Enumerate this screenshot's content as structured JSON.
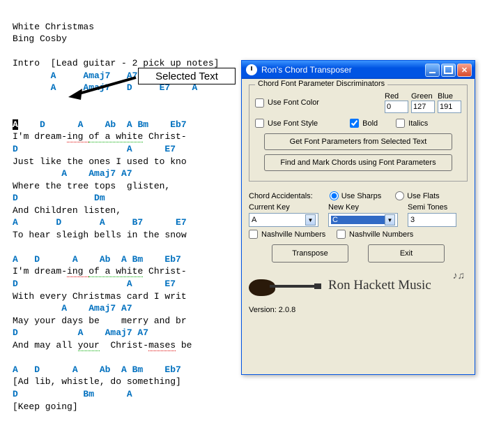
{
  "doc": {
    "title": "White Christmas",
    "artist": "Bing Cosby",
    "intro_label": "Intro",
    "intro_note": "[Lead guitar - 2 pick up notes]",
    "chord_rows": {
      "r1": "A     Amaj7   A7     D     Dm",
      "r2": "A     Amaj7   D     E7    A",
      "r3a": "    D      A    Ab  A Bm    Eb7",
      "r4a": "D                    A      E7",
      "r5a": "         A    Amaj7 A7",
      "r6a": "D              Dm",
      "r7a": "A       D       A     B7      E7",
      "r3b": "A   D      A    Ab  A Bm    Eb7",
      "r4b": "D                    A      E7",
      "r5b": "         A    Amaj7 A7",
      "r6b": "D           A    Amaj7 A7",
      "r8": "A   D      A    Ab  A Bm    Eb7",
      "r9": "D            Bm      A"
    },
    "lyrics": {
      "l1a": "I'm dream-",
      "l1b": "ing ",
      "l1c": "of a white",
      "l1d": " Christ-",
      "l2": "Just like the ones I used to kno",
      "l3": "Where the tree tops  glisten,",
      "l4": "And Children listen,",
      "l5": "To hear sleigh bells in the snow",
      "l6a": "I'm dream-",
      "l6b": "ing ",
      "l6c": "of a white",
      "l6d": " Christ-",
      "l7": "With every Christmas card I writ",
      "l8": "May your days be    merry and br",
      "l9": "And may all ",
      "l9b": "your",
      "l9c": "  Christ-",
      "l9d": "mases",
      "l9e": " be",
      "l10": "[Ad lib, whistle, do something]",
      "l11": "[Keep going]"
    },
    "selected_chord": "A"
  },
  "callout": "Selected Text",
  "dialog": {
    "title": "Ron's Chord Transposer",
    "group1": "Chord Font Parameter Discriminators",
    "use_font_color": "Use Font Color",
    "red": "Red",
    "green": "Green",
    "blue": "Blue",
    "red_v": "0",
    "green_v": "127",
    "blue_v": "191",
    "use_font_style": "Use Font Style",
    "bold_label": "Bold",
    "italics_label": "Italics",
    "btn_get": "Get Font Parameters from Selected Text",
    "btn_find": "Find and Mark Chords using Font Parameters",
    "accidentals": "Chord Accidentals:",
    "use_sharps": "Use Sharps",
    "use_flats": "Use Flats",
    "cur_key": "Current Key",
    "new_key": "New Key",
    "semi": "Semi Tones",
    "cur_key_v": "A",
    "new_key_v": "C",
    "semi_v": "3",
    "nashville": "Nashville Numbers",
    "transpose": "Transpose",
    "exit": "Exit",
    "signature": "Ron Hackett Music",
    "version": "Version: 2.0.8"
  }
}
